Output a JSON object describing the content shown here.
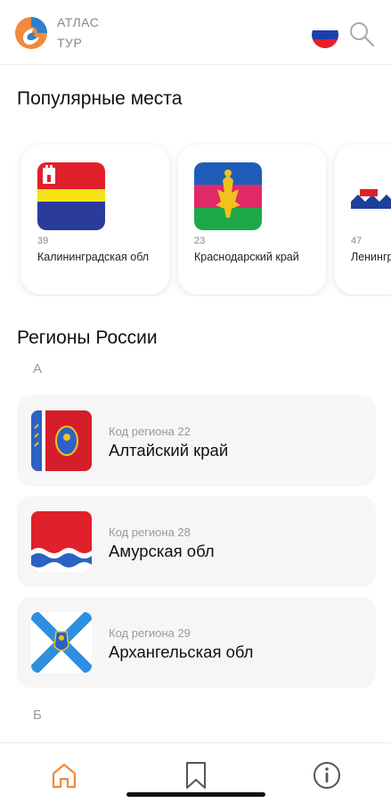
{
  "header": {
    "brand_line1": "АТЛАС",
    "brand_line2": "ТУР",
    "logo_icon": "atlas-logo",
    "language_icon": "russia-flag-icon",
    "search_icon": "search-icon"
  },
  "popular": {
    "title": "Популярные места",
    "items": [
      {
        "code": "39",
        "name": "Калининградская обл",
        "flag": "kaliningrad-flag"
      },
      {
        "code": "23",
        "name": "Краснодарский край",
        "flag": "krasnodar-flag"
      },
      {
        "code": "47",
        "name": "Ленинградская обл",
        "flag": "leningrad-flag"
      }
    ]
  },
  "regions": {
    "title": "Регионы России",
    "code_prefix": "Код региона",
    "groups": [
      {
        "letter": "А",
        "items": [
          {
            "code_label": "Код региона 22",
            "name": "Алтайский край",
            "flag": "altai-flag"
          },
          {
            "code_label": "Код региона 28",
            "name": "Амурская обл",
            "flag": "amur-flag"
          },
          {
            "code_label": "Код региона 29",
            "name": "Архангельская обл",
            "flag": "arkhangelsk-flag"
          }
        ]
      },
      {
        "letter": "Б",
        "items": []
      }
    ]
  },
  "tabbar": {
    "tabs": [
      {
        "icon": "home-icon",
        "active": true
      },
      {
        "icon": "bookmark-icon",
        "active": false
      },
      {
        "icon": "info-icon",
        "active": false
      }
    ]
  },
  "colors": {
    "accent": "#f08a3c",
    "logo_blue": "#2f7fd0",
    "tab_inactive": "#555555",
    "text_muted": "#999999"
  }
}
